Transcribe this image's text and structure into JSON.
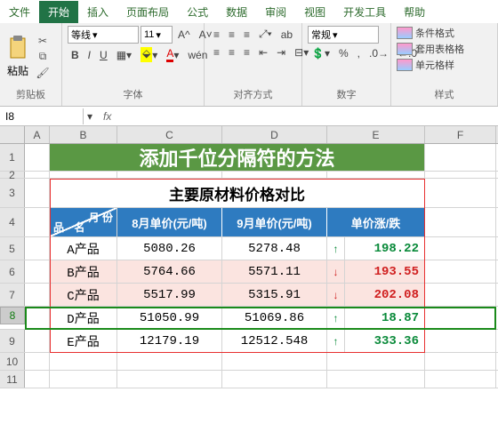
{
  "tabs": [
    "文件",
    "开始",
    "插入",
    "页面布局",
    "公式",
    "数据",
    "审阅",
    "视图",
    "开发工具",
    "帮助"
  ],
  "active_tab": 1,
  "ribbon": {
    "clipboard": {
      "paste": "粘贴",
      "label": "剪贴板"
    },
    "font": {
      "name": "等线",
      "size": "11",
      "label": "字体",
      "bold": "B",
      "italic": "I",
      "underline": "U"
    },
    "align": {
      "label": "对齐方式",
      "wrap": "ab"
    },
    "number": {
      "format": "常规",
      "label": "数字",
      "pct": "%"
    },
    "styles": {
      "label": "样式",
      "cond": "条件格式",
      "table": "套用表格格",
      "cell": "单元格样"
    }
  },
  "name_box": "I8",
  "fx": "fx",
  "columns": {
    "A": 28,
    "B": 76,
    "C": 118,
    "D": 118,
    "E": 20,
    "F_change": 90,
    "F": 80
  },
  "title": "添加千位分隔符的方法",
  "subtitle": "主要原材料价格对比",
  "headers": {
    "diag_top": "月 份",
    "diag_bottom": "品 名",
    "c": "8月单价(元/吨)",
    "d": "9月单价(元/吨)",
    "e": "单价涨/跌"
  },
  "chart_data": {
    "type": "table",
    "title": "主要原材料价格对比",
    "columns": [
      "品名",
      "8月单价(元/吨)",
      "9月单价(元/吨)",
      "单价涨/跌"
    ],
    "rows": [
      {
        "name": "A产品",
        "aug": 5080.26,
        "sep": 5278.48,
        "dir": "up",
        "change": 198.22
      },
      {
        "name": "B产品",
        "aug": 5764.66,
        "sep": 5571.11,
        "dir": "down",
        "change": 193.55
      },
      {
        "name": "C产品",
        "aug": 5517.99,
        "sep": 5315.91,
        "dir": "down",
        "change": 202.08
      },
      {
        "name": "D产品",
        "aug": 51050.99,
        "sep": 51069.86,
        "dir": "up",
        "change": 18.87
      },
      {
        "name": "E产品",
        "aug": 12179.19,
        "sep": 12512.548,
        "dir": "up",
        "change": 333.36
      }
    ]
  },
  "row_heights": {
    "1": 31,
    "2": 8,
    "3": 33,
    "4": 33,
    "data": 26,
    "empty": 20
  }
}
